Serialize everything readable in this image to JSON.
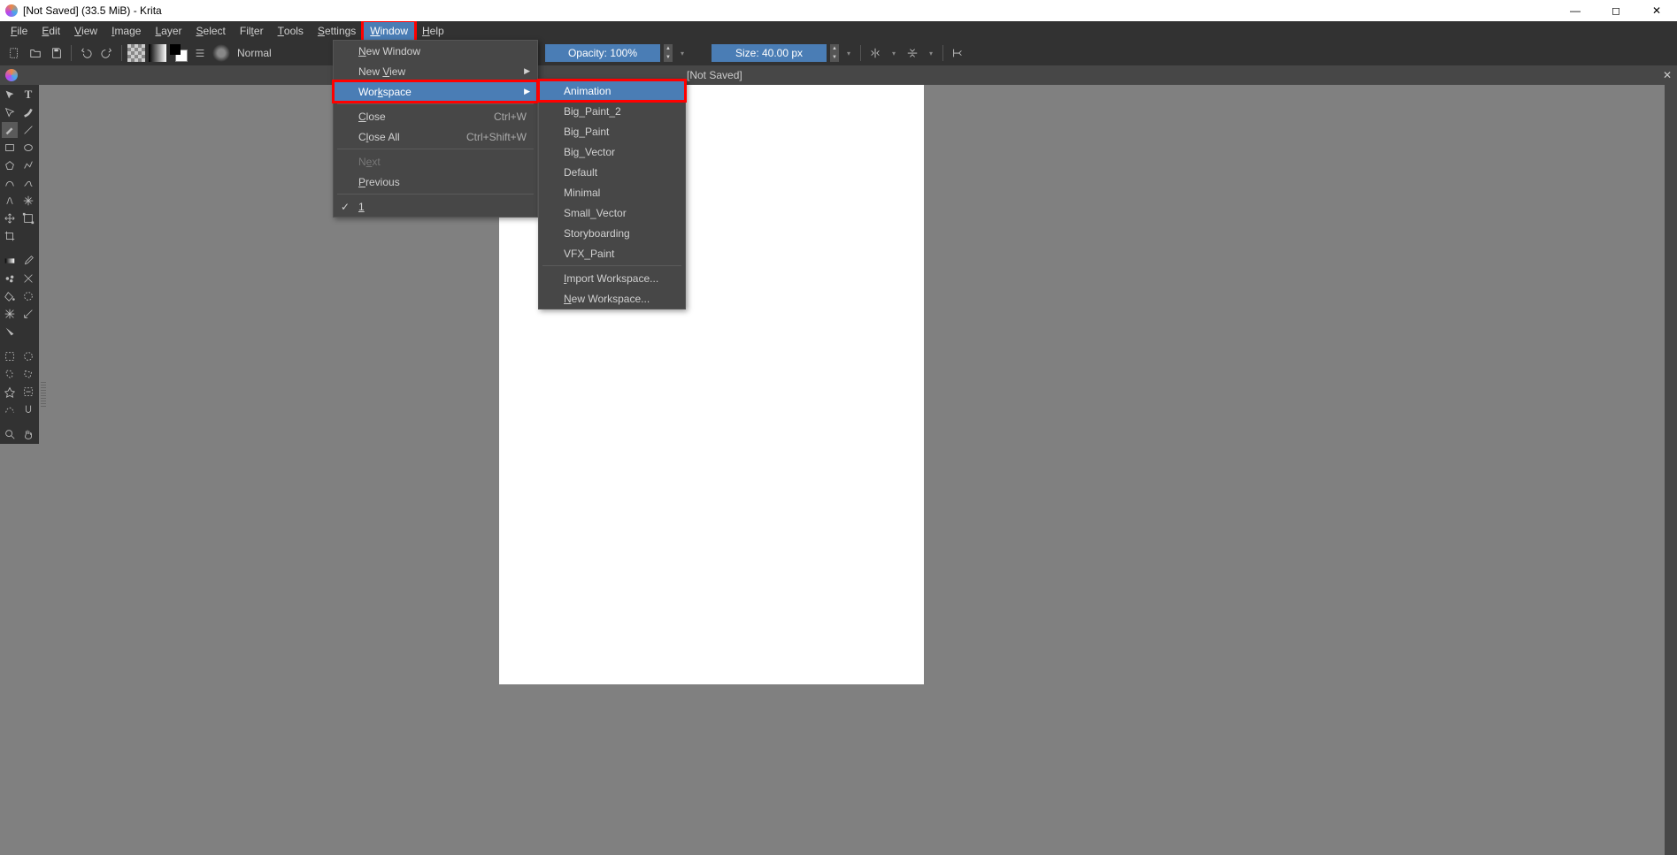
{
  "titlebar": {
    "text": "[Not Saved]  (33.5 MiB)  -  Krita"
  },
  "window_controls": {
    "min": "—",
    "max": "◻",
    "close": "✕"
  },
  "menubar": [
    {
      "label": "File",
      "u": 0
    },
    {
      "label": "Edit",
      "u": 0
    },
    {
      "label": "View",
      "u": 0
    },
    {
      "label": "Image",
      "u": 0
    },
    {
      "label": "Layer",
      "u": 0
    },
    {
      "label": "Select",
      "u": 0
    },
    {
      "label": "Filter",
      "u": 3
    },
    {
      "label": "Tools",
      "u": 0
    },
    {
      "label": "Settings",
      "u": 0
    },
    {
      "label": "Window",
      "u": 0,
      "highlighted": true
    },
    {
      "label": "Help",
      "u": 0
    }
  ],
  "toolbar": {
    "blend_mode": "Normal",
    "opacity_label": "Opacity: 100%",
    "size_label": "Size: 40.00 px"
  },
  "doctab": {
    "name": "[Not Saved]"
  },
  "window_menu": [
    {
      "label": "New Window",
      "u": 0
    },
    {
      "label": "New View",
      "u": 4,
      "arrow": true
    },
    {
      "label": "Workspace",
      "u": 3,
      "arrow": true,
      "hovered": true,
      "boxed": true
    },
    {
      "sep": true
    },
    {
      "label": "Close",
      "u": 0,
      "shortcut": "Ctrl+W"
    },
    {
      "label": "Close All",
      "u": 1,
      "shortcut": "Ctrl+Shift+W"
    },
    {
      "sep": true
    },
    {
      "label": "Next",
      "u": 1,
      "disabled": true
    },
    {
      "label": "Previous",
      "u": 0
    },
    {
      "sep": true
    },
    {
      "label": "1",
      "u": 0,
      "check": true
    }
  ],
  "workspace_menu": [
    {
      "label": "Animation",
      "hovered": true,
      "boxed": true
    },
    {
      "label": "Big_Paint_2"
    },
    {
      "label": "Big_Paint"
    },
    {
      "label": "Big_Vector"
    },
    {
      "label": "Default"
    },
    {
      "label": "Minimal"
    },
    {
      "label": "Small_Vector"
    },
    {
      "label": "Storyboarding"
    },
    {
      "label": "VFX_Paint"
    },
    {
      "sep": true
    },
    {
      "label": "Import Workspace...",
      "u": 0
    },
    {
      "label": "New Workspace...",
      "u": 0
    }
  ]
}
